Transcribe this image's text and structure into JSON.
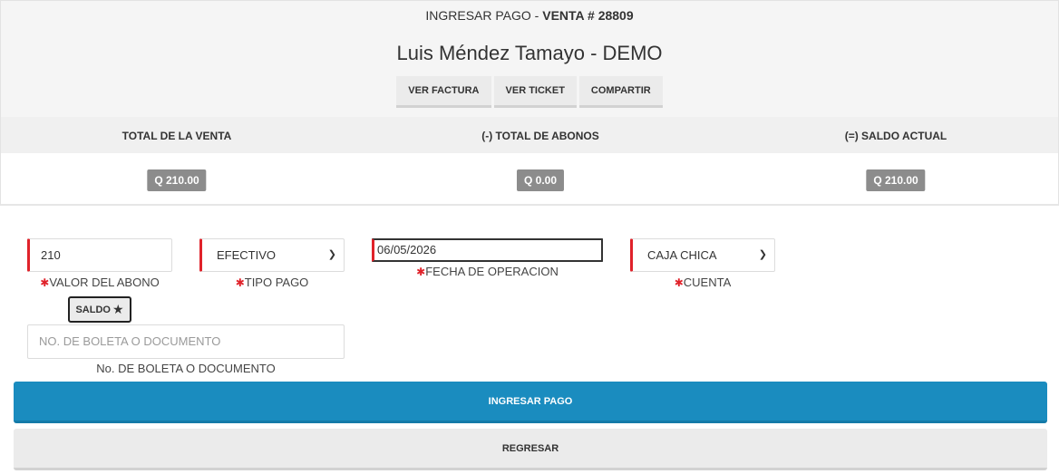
{
  "header": {
    "prefix": "INGRESAR PAGO - ",
    "venta_label": "VENTA # 28809",
    "client_name": "Luis Méndez Tamayo - DEMO"
  },
  "actions": {
    "ver_factura": "VER FACTURA",
    "ver_ticket": "VER TICKET",
    "compartir": "COMPARTIR"
  },
  "totals": {
    "total_venta_label": "TOTAL DE LA VENTA",
    "total_abonos_label": "(-) TOTAL DE ABONOS",
    "saldo_actual_label": "(=) SALDO ACTUAL",
    "total_venta_value": "Q 210.00",
    "total_abonos_value": "Q 0.00",
    "saldo_actual_value": "Q 210.00"
  },
  "form": {
    "required_mark": "✱",
    "valor_abono": {
      "value": "210",
      "label": "VALOR DEL ABONO"
    },
    "tipo_pago": {
      "value": "EFECTIVO",
      "label": "TIPO PAGO"
    },
    "fecha": {
      "value": "06/05/2026",
      "label": "FECHA DE OPERACION"
    },
    "cuenta": {
      "value": "CAJA CHICA",
      "label": "CUENTA"
    },
    "saldo_button": "SALDO",
    "saldo_icon": "★",
    "boleta": {
      "placeholder": "NO. DE BOLETA O DOCUMENTO",
      "label": "No. DE BOLETA O DOCUMENTO"
    }
  },
  "buttons": {
    "ingresar_pago": "INGRESAR PAGO",
    "regresar": "REGRESAR"
  },
  "icons": {
    "select_chevron": "chevron-down-icon",
    "required": "asterisk-icon",
    "saldo": "star-icon"
  },
  "colors": {
    "primary": "#1a8cbf",
    "required": "#e0222a",
    "badge": "#8c8c8c"
  }
}
